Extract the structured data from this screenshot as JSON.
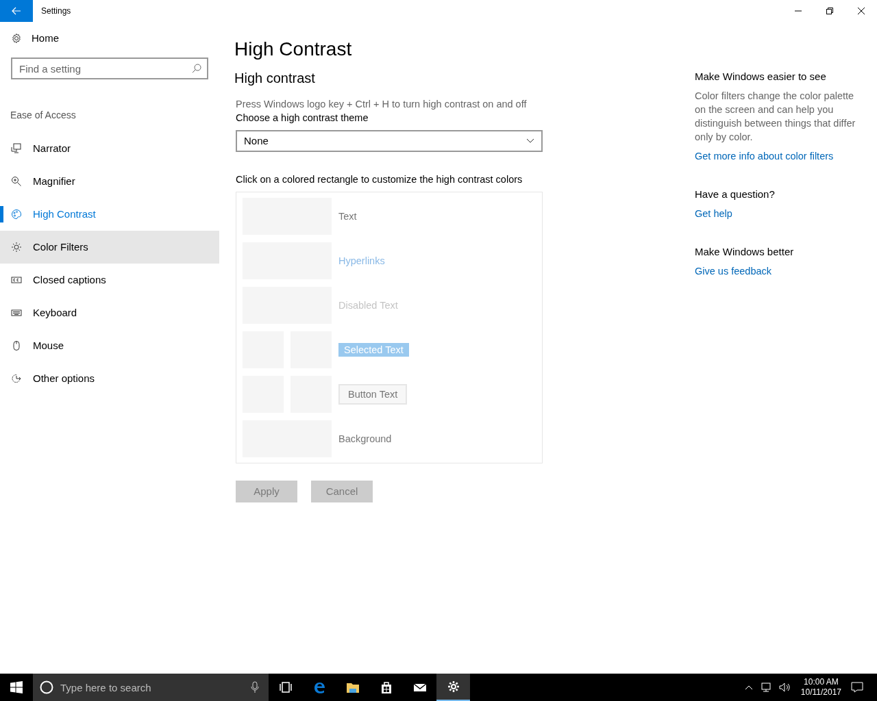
{
  "window": {
    "title": "Settings"
  },
  "sidebar": {
    "home": "Home",
    "search": {
      "placeholder": "Find a setting"
    },
    "section": "Ease of Access",
    "items": [
      {
        "label": "Narrator",
        "kind": "narrator",
        "selected": false,
        "hovered": false
      },
      {
        "label": "Magnifier",
        "kind": "magnifier",
        "selected": false,
        "hovered": false
      },
      {
        "label": "High Contrast",
        "kind": "palette",
        "selected": true,
        "hovered": false
      },
      {
        "label": "Color Filters",
        "kind": "sun",
        "selected": false,
        "hovered": true
      },
      {
        "label": "Closed captions",
        "kind": "cc",
        "selected": false,
        "hovered": false
      },
      {
        "label": "Keyboard",
        "kind": "keyboard",
        "selected": false,
        "hovered": false
      },
      {
        "label": "Mouse",
        "kind": "mouse",
        "selected": false,
        "hovered": false
      },
      {
        "label": "Other options",
        "kind": "other",
        "selected": false,
        "hovered": false
      }
    ]
  },
  "page": {
    "title": "High Contrast",
    "section": "High contrast",
    "hint": "Press Windows logo key + Ctrl + H to turn high contrast on and off",
    "theme_label": "Choose a high contrast theme",
    "theme_value": "None",
    "colors_label": "Click on a colored rectangle to customize the high contrast colors",
    "color_rows": [
      {
        "label": "Text",
        "kind": "text"
      },
      {
        "label": "Hyperlinks",
        "kind": "link"
      },
      {
        "label": "Disabled Text",
        "kind": "disabled"
      },
      {
        "label": "Selected Text",
        "kind": "selected"
      },
      {
        "label": "Button Text",
        "kind": "button"
      },
      {
        "label": "Background",
        "kind": "background"
      }
    ],
    "buttons": [
      {
        "label": "Apply",
        "disabled": true
      },
      {
        "label": "Cancel",
        "disabled": true
      }
    ]
  },
  "aside": [
    {
      "heading": "Make Windows easier to see",
      "body": "Color filters change the color palette on the screen and can help you distinguish between things that differ only by color.",
      "link": "Get more info about color filters"
    },
    {
      "heading": "Have a question?",
      "link": "Get help"
    },
    {
      "heading": "Make Windows better",
      "link": "Give us feedback"
    }
  ],
  "taskbar": {
    "search_placeholder": "Type here to search",
    "apps": [
      {
        "kind": "taskview",
        "active": false
      },
      {
        "kind": "edge",
        "active": false
      },
      {
        "kind": "folder",
        "active": false
      },
      {
        "kind": "store",
        "active": false
      },
      {
        "kind": "mail",
        "active": false
      },
      {
        "kind": "gear",
        "active": true
      }
    ],
    "time": "10:00 AM",
    "date": "10/11/2017"
  }
}
